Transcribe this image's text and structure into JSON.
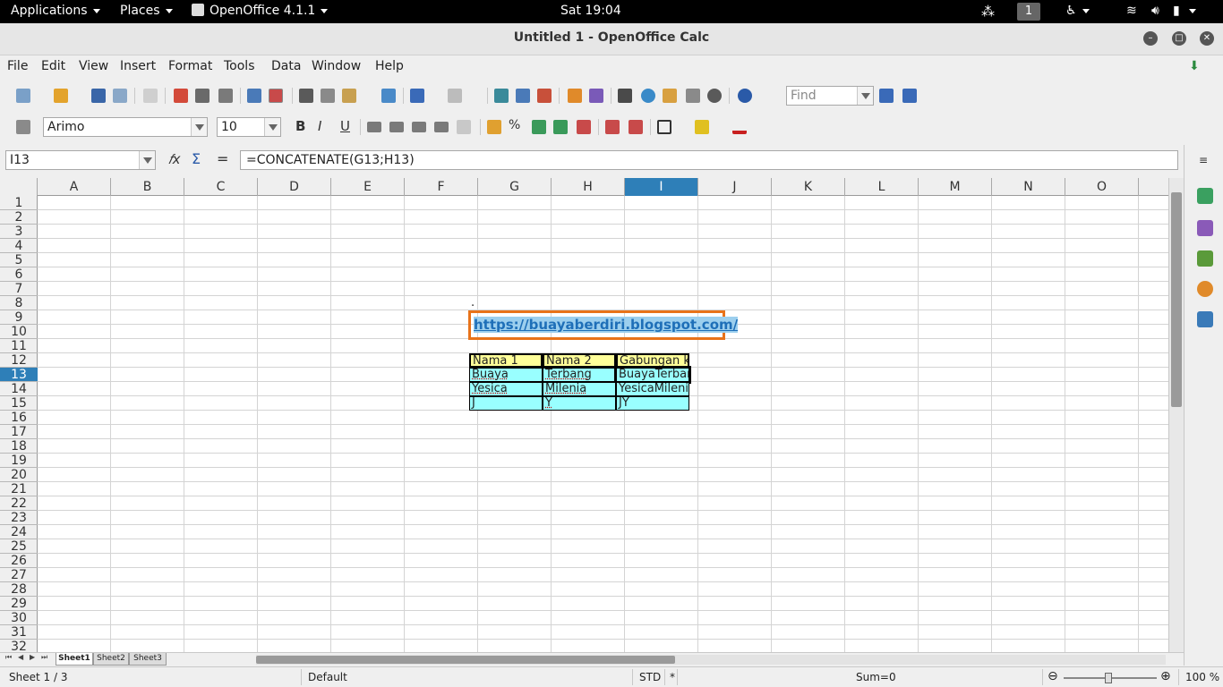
{
  "topbar": {
    "applications": "Applications",
    "places": "Places",
    "app_name": "OpenOffice 4.1.1",
    "clock": "Sat 19:04",
    "workspace": "1"
  },
  "window": {
    "title": "Untitled 1 - OpenOffice Calc"
  },
  "menu": [
    "File",
    "Edit",
    "View",
    "Insert",
    "Format",
    "Tools",
    "Data",
    "Window",
    "Help"
  ],
  "find": {
    "placeholder": "Find"
  },
  "font": {
    "name": "Arimo",
    "size": "10"
  },
  "format_buttons": {
    "bold": "B",
    "italic": "I",
    "underline": "U"
  },
  "formula_bar": {
    "cell_ref": "I13",
    "formula": "=CONCATENATE(G13;H13)",
    "fx": "𝑓x",
    "sum": "Σ",
    "equals": "="
  },
  "columns": [
    "A",
    "B",
    "C",
    "D",
    "E",
    "F",
    "G",
    "H",
    "I",
    "J",
    "K",
    "L",
    "M",
    "N",
    "O"
  ],
  "rows": [
    "1",
    "2",
    "3",
    "4",
    "5",
    "6",
    "7",
    "8",
    "9",
    "10",
    "11",
    "12",
    "13",
    "14",
    "15",
    "16",
    "17",
    "18",
    "19",
    "20",
    "21",
    "22",
    "23",
    "24",
    "25",
    "26",
    "27",
    "28",
    "29",
    "30",
    "31",
    "32"
  ],
  "selected": {
    "column": "I",
    "row": "13"
  },
  "cells": {
    "g8": ".",
    "link": "https://buayaberdiri.blogspot.com/",
    "table": {
      "header": [
        "Nama 1",
        "Nama 2",
        "Gabungan kata"
      ],
      "rows": [
        [
          "Buaya",
          "Terbang",
          "BuayaTerbang"
        ],
        [
          "Yesica",
          "Milenia",
          "YesicaMilenia"
        ],
        [
          "J",
          "Y",
          "JY"
        ]
      ]
    }
  },
  "sheets": [
    "Sheet1",
    "Sheet2",
    "Sheet3"
  ],
  "status": {
    "sheet": "Sheet 1 / 3",
    "style": "Default",
    "mode": "STD",
    "modified": "*",
    "sum": "Sum=0",
    "zoom": "100 %"
  },
  "colors": {
    "header_fill": "#ffff99",
    "data_fill": "#99ffff",
    "link_border": "#e8731a",
    "link_text": "#1e6fb8",
    "selection": "#2e7fb8"
  }
}
